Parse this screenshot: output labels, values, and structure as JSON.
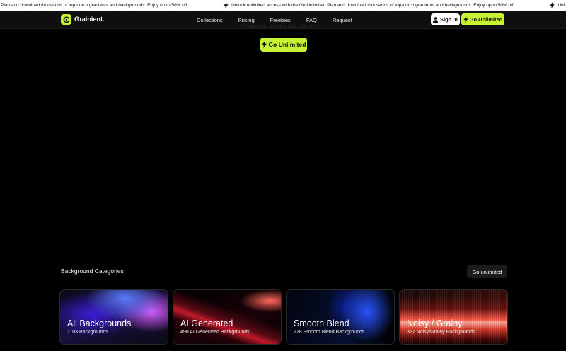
{
  "ticker": {
    "items": [
      "Plan and download thousands of top-notch gradients and backgrounds. Enjoy up to 50% off.",
      "Unlock unlimited access with the Go Unlimited Plan and download thousands of top-notch gradients and backgrounds. Enjoy up to 50% off.",
      "Unlock unli"
    ]
  },
  "nav": {
    "brand": "Grainient.",
    "links": [
      "Collections",
      "Pricing",
      "Freebies",
      "FAQ",
      "Request"
    ],
    "sign_in": "Sign in",
    "go_unlimited": "Go Unlimited"
  },
  "hero": {
    "ghost_text": "Elevate your designs with Grainient.",
    "cta": "Go Unlimited"
  },
  "categories": {
    "title": "Background Categories",
    "button": "Go unlimited",
    "cards": [
      {
        "title": "All Backgrounds",
        "subtitle": "1103 Backgrounds."
      },
      {
        "title": "AI Generated",
        "subtitle": "498 AI Generated Backgrounds"
      },
      {
        "title": "Smooth Blend",
        "subtitle": "278 Smooth Blend Backgrounds."
      },
      {
        "title": "Noisy / Grainy",
        "subtitle": "327 Noisy/Grainy Backgrounds."
      }
    ]
  },
  "colors": {
    "accent": "#c6f432",
    "background": "#000000",
    "nav_background": "#0f0f0f"
  }
}
